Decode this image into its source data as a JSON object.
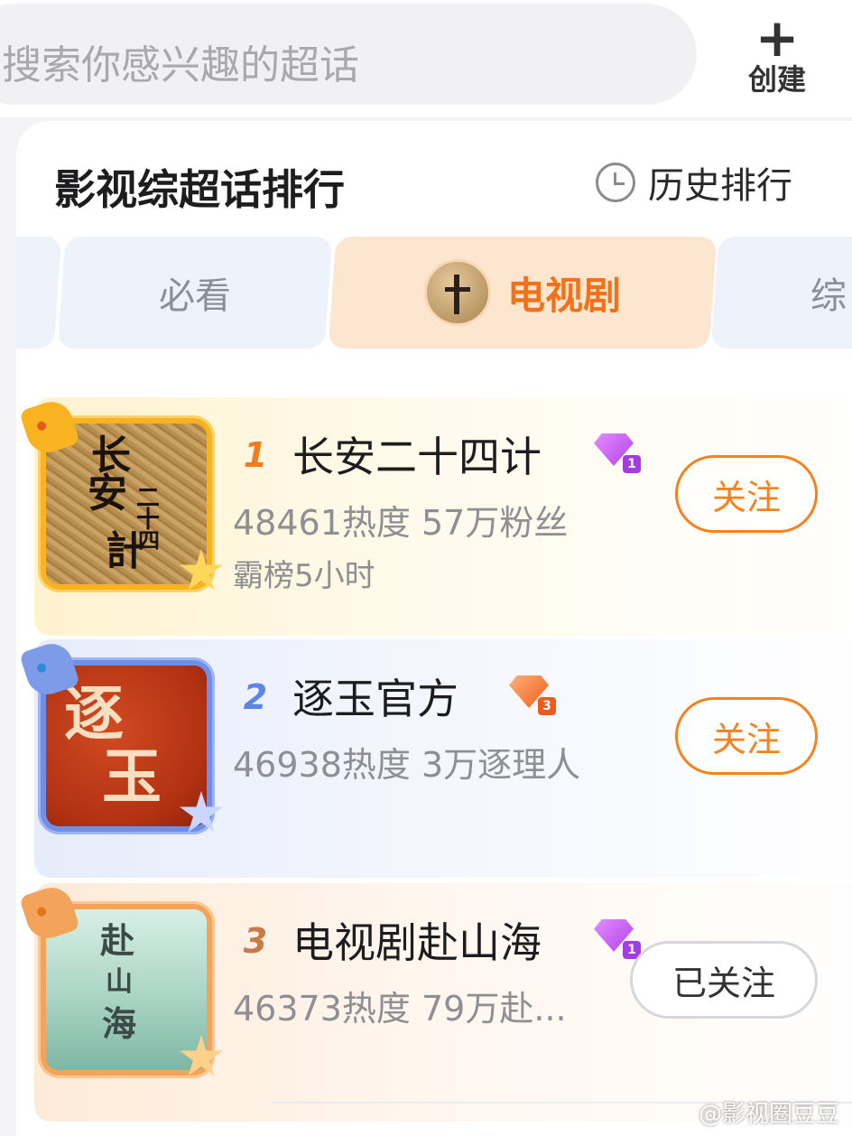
{
  "search": {
    "placeholder": "搜索你感兴趣的超话",
    "create_label": "创建"
  },
  "section": {
    "title": "影视综超话排行",
    "history_label": "历史排行"
  },
  "tabs": [
    {
      "label": "必看",
      "active": false
    },
    {
      "label": "电视剧",
      "active": true
    },
    {
      "label": "综",
      "active": false
    }
  ],
  "ranking": [
    {
      "rank": "1",
      "name": "长安二十四计",
      "level": "1",
      "stats": "48461热度 57万粉丝",
      "extra": "霸榜5小时",
      "follow_label": "关注",
      "followed": false,
      "cover_text": [
        "长",
        "安",
        "二",
        "十",
        "四",
        "計"
      ]
    },
    {
      "rank": "2",
      "name": "逐玉官方",
      "level": "3",
      "stats": "46938热度 3万逐理人",
      "extra": "",
      "follow_label": "关注",
      "followed": false,
      "cover_text": [
        "逐",
        "玉"
      ]
    },
    {
      "rank": "3",
      "name": "电视剧赴山海",
      "level": "1",
      "stats": "46373热度 79万赴...",
      "extra": "",
      "follow_label": "已关注",
      "followed": true,
      "cover_text": [
        "赴",
        "山",
        "海"
      ]
    }
  ],
  "watermark": "@影视圈豆豆",
  "colors": {
    "accent": "#f5701a",
    "follow": "#f5821f",
    "active_tab_bg": "#fde6d0",
    "inactive_tab_bg": "#eef2fb"
  },
  "icons": {
    "create": "plus-icon",
    "history": "clock-icon",
    "level_1": "purple-gem-icon",
    "level_3": "orange-gem-icon"
  }
}
